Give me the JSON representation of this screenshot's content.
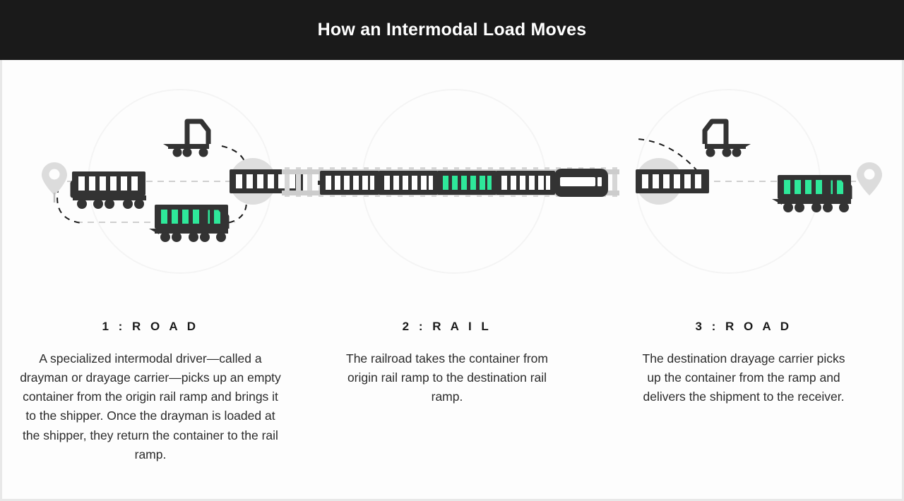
{
  "header": {
    "title": "How an Intermodal Load Moves"
  },
  "colors": {
    "header_bg": "#1a1a1a",
    "page_bg": "#fdfdfd",
    "dark": "#333333",
    "accent_green": "#2EE89A",
    "light_gray": "#d8d8d8",
    "track_gray": "#d0d0d0",
    "pin_gray": "#dcdcdc",
    "circle_outline": "#f2f2f2",
    "dash_gray": "#cccccc",
    "dash_dark": "#1a1a1a"
  },
  "steps": [
    {
      "id": "step-1",
      "title": "1 :  R O A D",
      "body": "A specialized intermodal driver—called a drayman or drayage carrier—picks up an empty container from the origin rail ramp and brings it to the shipper. Once the drayman is loaded at the shipper, they return the container to the rail ramp."
    },
    {
      "id": "step-2",
      "title": "2 :  R A I L",
      "body": "The railroad takes the container from origin rail ramp to the destination rail ramp."
    },
    {
      "id": "step-3",
      "title": "3 :  R O A D",
      "body": "The destination drayage carrier picks up the container from the ramp and delivers the shipment to the receiver."
    }
  ],
  "illustration": {
    "elements": [
      {
        "name": "origin-location-pin",
        "label": "origin pin",
        "section": "road-1"
      },
      {
        "name": "truck-empty-container-left",
        "label": "truck with empty container heading to shipper",
        "section": "road-1"
      },
      {
        "name": "chassis-truck-outbound",
        "label": "empty chassis truck returning to ramp",
        "section": "road-1"
      },
      {
        "name": "truck-loaded-container-right",
        "label": "truck with loaded container returning to ramp",
        "section": "road-1"
      },
      {
        "name": "origin-rail-ramp",
        "label": "origin rail ramp",
        "section": "road-1"
      },
      {
        "name": "freight-train",
        "label": "intermodal freight train on track",
        "section": "rail"
      },
      {
        "name": "destination-rail-ramp",
        "label": "destination rail ramp",
        "section": "road-2"
      },
      {
        "name": "chassis-truck-pickup",
        "label": "empty chassis truck arriving at ramp",
        "section": "road-2"
      },
      {
        "name": "truck-loaded-container-delivery",
        "label": "truck delivering loaded container",
        "section": "road-2"
      },
      {
        "name": "destination-location-pin",
        "label": "destination pin",
        "section": "road-2"
      }
    ],
    "train": {
      "cars": [
        {
          "type": "container",
          "loaded": false
        },
        {
          "type": "container",
          "loaded": false
        },
        {
          "type": "container",
          "loaded": true
        },
        {
          "type": "container",
          "loaded": false
        },
        {
          "type": "locomotive",
          "loaded": false
        }
      ]
    }
  }
}
